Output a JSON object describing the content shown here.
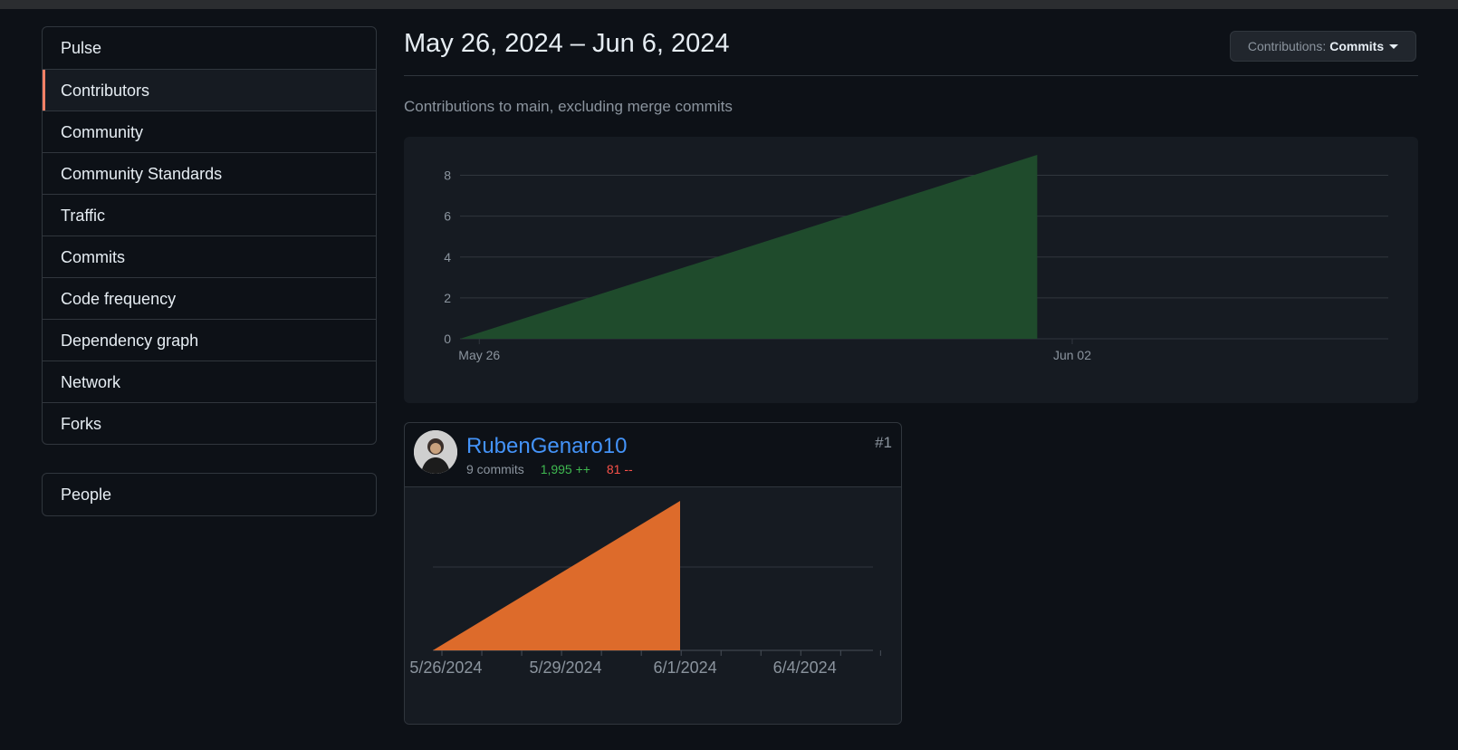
{
  "sidebar": {
    "items": [
      {
        "label": "Pulse"
      },
      {
        "label": "Contributors",
        "selected": true
      },
      {
        "label": "Community"
      },
      {
        "label": "Community Standards"
      },
      {
        "label": "Traffic"
      },
      {
        "label": "Commits"
      },
      {
        "label": "Code frequency"
      },
      {
        "label": "Dependency graph"
      },
      {
        "label": "Network"
      },
      {
        "label": "Forks"
      }
    ],
    "people_label": "People"
  },
  "header": {
    "range_title": "May 26, 2024 – Jun 6, 2024",
    "contributions_prefix": "Contributions:",
    "contributions_value": "Commits",
    "subtitle": "Contributions to main, excluding merge commits"
  },
  "colors": {
    "accent": "#f78166",
    "overview_fill": "#1f4b2c",
    "contributor_fill": "#dd6b2b",
    "link": "#4493f8",
    "additions": "#3fb950",
    "deletions": "#f85149"
  },
  "chart_data": [
    {
      "type": "area",
      "x": [
        "May 26",
        "Jun 01"
      ],
      "y": [
        0,
        9
      ],
      "x_ticks": [
        "May 26",
        "Jun 02"
      ],
      "y_ticks": [
        0,
        2,
        4,
        6,
        8
      ],
      "ylim": [
        0,
        9
      ],
      "grid": true
    },
    {
      "type": "area",
      "x": [
        "5/26/2024",
        "6/1/2024"
      ],
      "y": [
        0,
        9
      ],
      "x_ticks": [
        "5/26/2024",
        "5/29/2024",
        "6/1/2024",
        "6/4/2024"
      ],
      "grid": true
    }
  ],
  "contributor": {
    "rank": "#1",
    "username": "RubenGenaro10",
    "commits": "9 commits",
    "additions": "1,995 ++",
    "deletions": "81 --"
  },
  "icons": {
    "avatar": "user-avatar",
    "caret": "caret-down-icon"
  }
}
